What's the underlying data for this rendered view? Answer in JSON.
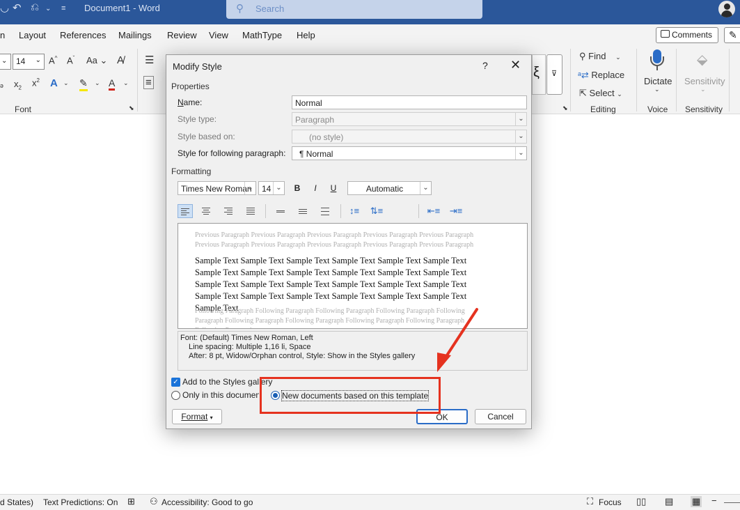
{
  "titlebar": {
    "doc_title": "Document1 - Word",
    "search_placeholder": "Search"
  },
  "menu": {
    "tabs": [
      "n",
      "Layout",
      "References",
      "Mailings",
      "Review",
      "View",
      "MathType",
      "Help"
    ],
    "comments": "Comments"
  },
  "ribbon": {
    "font_size": "14",
    "font_group": "Font",
    "find": "Find",
    "replace": "Replace",
    "select": "Select",
    "editing_group": "Editing",
    "dictate": "Dictate",
    "voice_group": "Voice",
    "sensitivity": "Sensitivity",
    "sensitivity_group": "Sensitivity"
  },
  "dialog": {
    "title": "Modify Style",
    "properties_header": "Properties",
    "name_label": "Name:",
    "name_value": "Normal",
    "style_type_label": "Style type:",
    "style_type_value": "Paragraph",
    "based_on_label": "Style based on:",
    "based_on_value": "(no style)",
    "following_label": "Style for following paragraph:",
    "following_value": "¶ Normal",
    "formatting_header": "Formatting",
    "font_name": "Times New Roman",
    "font_size": "14",
    "bold": "B",
    "italic": "I",
    "underline": "U",
    "color": "Automatic",
    "preview_prev": "Previous Paragraph Previous Paragraph Previous Paragraph Previous Paragraph Previous Paragraph Previous Paragraph Previous Paragraph Previous Paragraph Previous Paragraph Previous Paragraph",
    "preview_sample": "Sample Text Sample Text Sample Text Sample Text Sample Text Sample Text Sample Text Sample Text Sample Text Sample Text Sample Text Sample Text Sample Text Sample Text Sample Text Sample Text Sample Text Sample Text Sample Text Sample Text Sample Text Sample Text Sample Text Sample Text Sample Text",
    "preview_follow": "Following Paragraph Following Paragraph Following Paragraph Following Paragraph Following Paragraph Following Paragraph Following Paragraph Following Paragraph Following Paragraph Following Paragraph",
    "desc_line1": "Font: (Default) Times New Roman, Left",
    "desc_line2": "Line spacing:  Multiple 1,16 li, Space",
    "desc_line3": "After:  8 pt, Widow/Orphan control, Style: Show in the Styles gallery",
    "add_gallery": "Add to the Styles gallery",
    "only_doc": "Only in this document",
    "new_docs": "New documents based on this template",
    "format_btn": "Format",
    "ok_btn": "OK",
    "cancel_btn": "Cancel"
  },
  "statusbar": {
    "lang": "d States)",
    "predictions": "Text Predictions: On",
    "accessibility": "Accessibility: Good to go",
    "focus": "Focus"
  },
  "colors": {
    "title_bar": "#2b579a",
    "highlight": "#e5321f"
  }
}
